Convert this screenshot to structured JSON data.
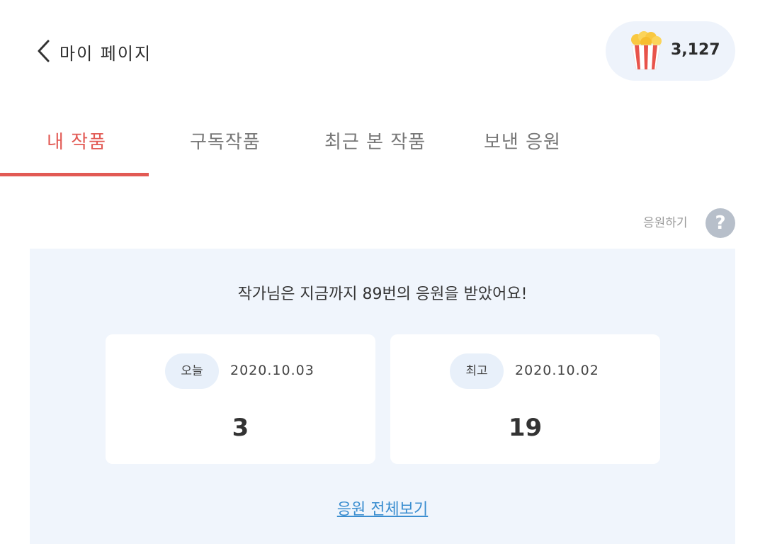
{
  "header": {
    "title": "마이 페이지",
    "back_icon": "chevron-left-icon",
    "points_icon": "popcorn-icon",
    "points": "3,127"
  },
  "tabs": [
    {
      "label": "내 작품",
      "active": true
    },
    {
      "label": "구독작품",
      "active": false
    },
    {
      "label": "최근 본 작품",
      "active": false
    },
    {
      "label": "보낸 응원",
      "active": false
    }
  ],
  "help": {
    "label": "응원하기",
    "icon": "question-icon",
    "icon_glyph": "?"
  },
  "support": {
    "summary": "작가님은 지금까지 89번의 응원을 받았어요!",
    "today": {
      "badge": "오늘",
      "date": "2020.10.03",
      "value": "3"
    },
    "best": {
      "badge": "최고",
      "date": "2020.10.02",
      "value": "19"
    },
    "view_all": "응원 전체보기"
  },
  "colors": {
    "accent": "#e25a54",
    "panel_bg": "#f0f5fc",
    "link": "#3b8ed0"
  }
}
